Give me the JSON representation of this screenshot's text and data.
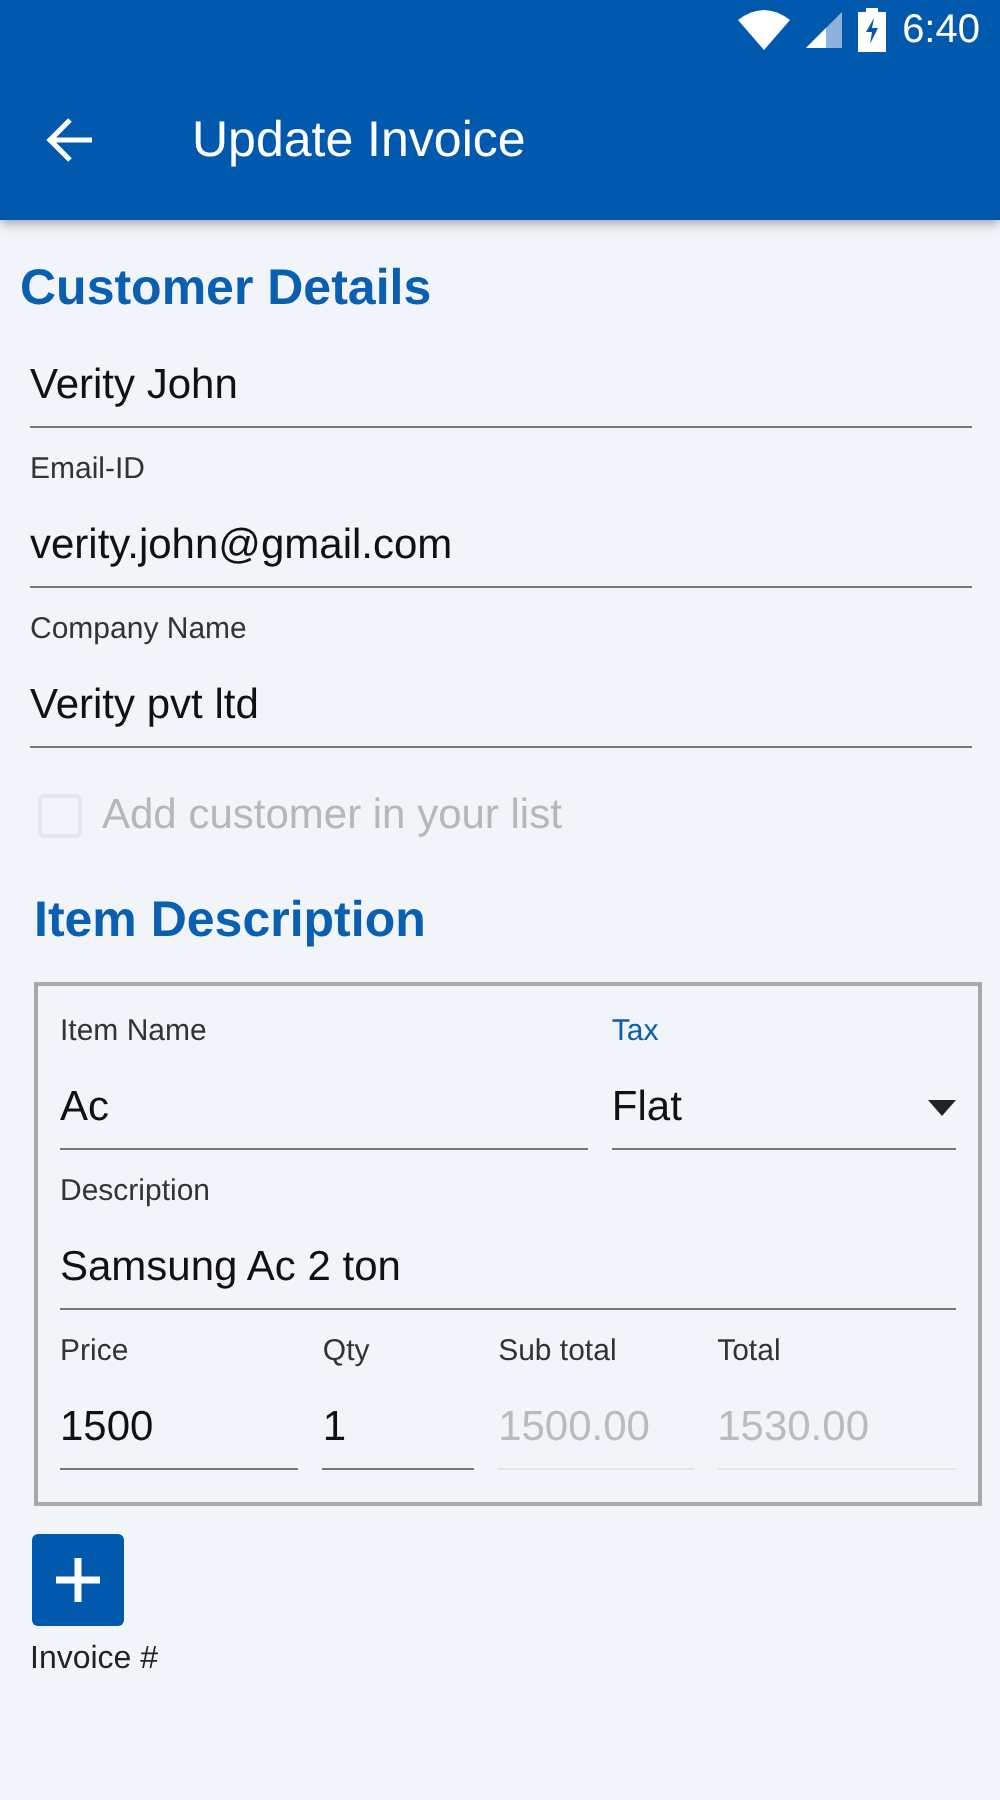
{
  "status_bar": {
    "time": "6:40"
  },
  "app_bar": {
    "title": "Update Invoice"
  },
  "customer": {
    "heading": "Customer Details",
    "fields": [
      {
        "value": "Verity John"
      },
      {
        "label": "Email-ID",
        "value": "verity.john@gmail.com"
      },
      {
        "label": "Company Name",
        "value": "Verity pvt ltd"
      }
    ],
    "add_to_list": {
      "label": "Add customer in your list",
      "checked": false,
      "disabled": true
    }
  },
  "item": {
    "heading": "Item Description",
    "rows": [
      [
        {
          "kind": "text",
          "label": "Item Name",
          "value": "Ac",
          "focused": false,
          "disabled": false
        },
        {
          "kind": "dropdown",
          "label": "Tax",
          "value": "Flat",
          "focused": true
        }
      ],
      [
        {
          "kind": "text",
          "label": "Description",
          "value": "Samsung Ac 2 ton",
          "focused": false,
          "disabled": false
        }
      ],
      [
        {
          "kind": "text",
          "label": "Price",
          "value": "1500",
          "focused": false,
          "disabled": false
        },
        {
          "kind": "text",
          "label": "Qty",
          "value": "1",
          "focused": false,
          "disabled": false
        },
        {
          "kind": "text",
          "label": "Sub total",
          "value": "1500.00",
          "focused": false,
          "disabled": true
        },
        {
          "kind": "text",
          "label": "Total",
          "value": "1530.00",
          "focused": false,
          "disabled": true
        }
      ]
    ]
  },
  "invoice_label": "Invoice #"
}
